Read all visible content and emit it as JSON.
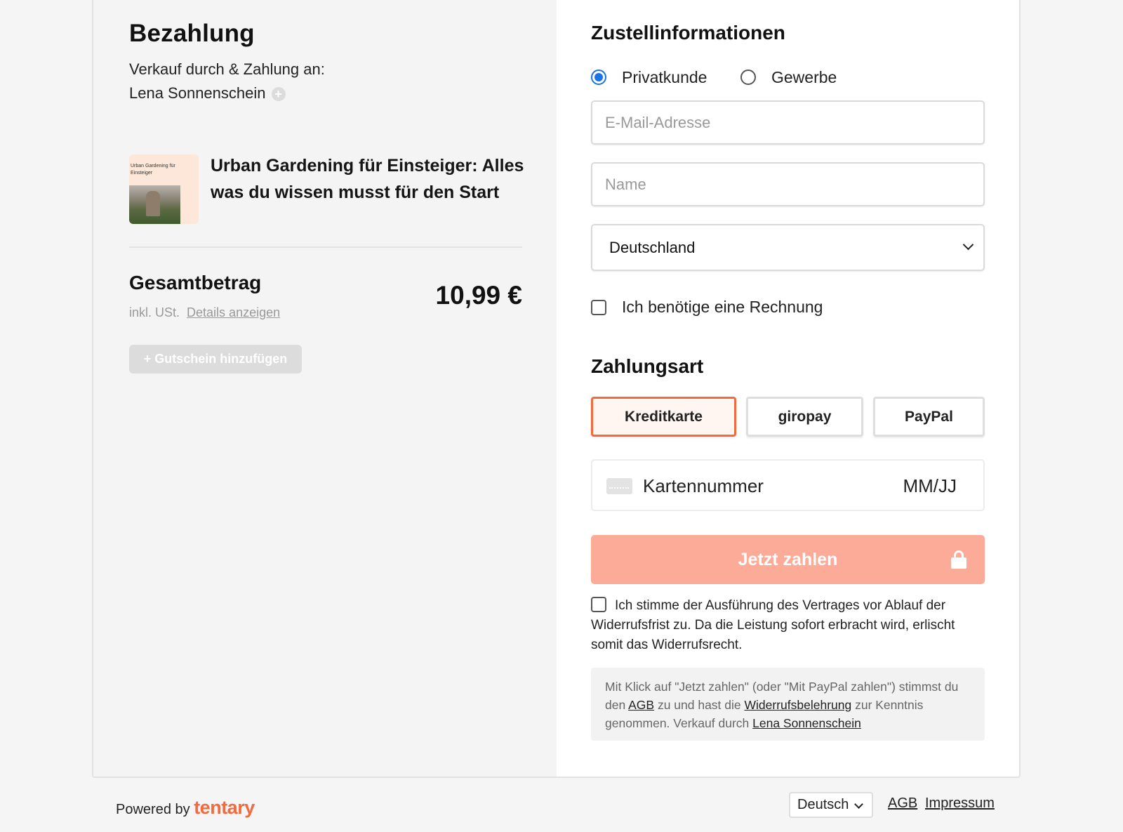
{
  "left": {
    "title": "Bezahlung",
    "seller_intro": "Verkauf durch & Zahlung an:",
    "seller_name": "Lena Sonnenschein",
    "product": {
      "thumb_text": "Urban Gardening für Einsteiger",
      "title": "Urban Gardening für Einsteiger: Alles was du wissen musst für den Start"
    },
    "total": {
      "label": "Gesamtbetrag",
      "tax_note": "inkl. USt.",
      "details_link": "Details anzeigen",
      "amount": "10,99 €"
    },
    "coupon_button": "+ Gutschein hinzufügen"
  },
  "right": {
    "delivery_title": "Zustellinformationen",
    "customer_types": [
      {
        "label": "Privatkunde",
        "selected": true
      },
      {
        "label": "Gewerbe",
        "selected": false
      }
    ],
    "email_placeholder": "E-Mail-Adresse",
    "name_placeholder": "Name",
    "country": "Deutschland",
    "invoice_label": "Ich benötige eine Rechnung",
    "payment_title": "Zahlungsart",
    "payment_methods": [
      {
        "label": "Kreditkarte",
        "active": true
      },
      {
        "label": "giropay",
        "active": false
      },
      {
        "label": "PayPal",
        "active": false
      }
    ],
    "card_number_placeholder": "Kartennummer",
    "card_expiry_placeholder": "MM/JJ",
    "pay_button": "Jetzt zahlen",
    "consent_text": "Ich stimme der Ausführung des Vertrages vor Ablauf der Widerrufsfrist zu. Da die Leistung sofort erbracht wird, erlischt somit das Widerrufsrecht.",
    "legal": {
      "part1": "Mit Klick auf \"Jetzt zahlen\" (oder \"Mit PayPal zahlen\") stimmst du den ",
      "agb_link": "AGB",
      "part2": " zu und hast die ",
      "widerruf_link": "Widerrufsbelehrung",
      "part3": " zur Kenntnis genommen. Verkauf durch ",
      "seller_link": "Lena Sonnenschein"
    }
  },
  "footer": {
    "powered_by": "Powered by",
    "brand": "tentary",
    "language": "Deutsch",
    "agb_link": "AGB",
    "impressum_link": "Impressum"
  },
  "colors": {
    "accent": "#f26a3d",
    "pay_button": "#fbab98",
    "radio_selected": "#1a73e8"
  }
}
